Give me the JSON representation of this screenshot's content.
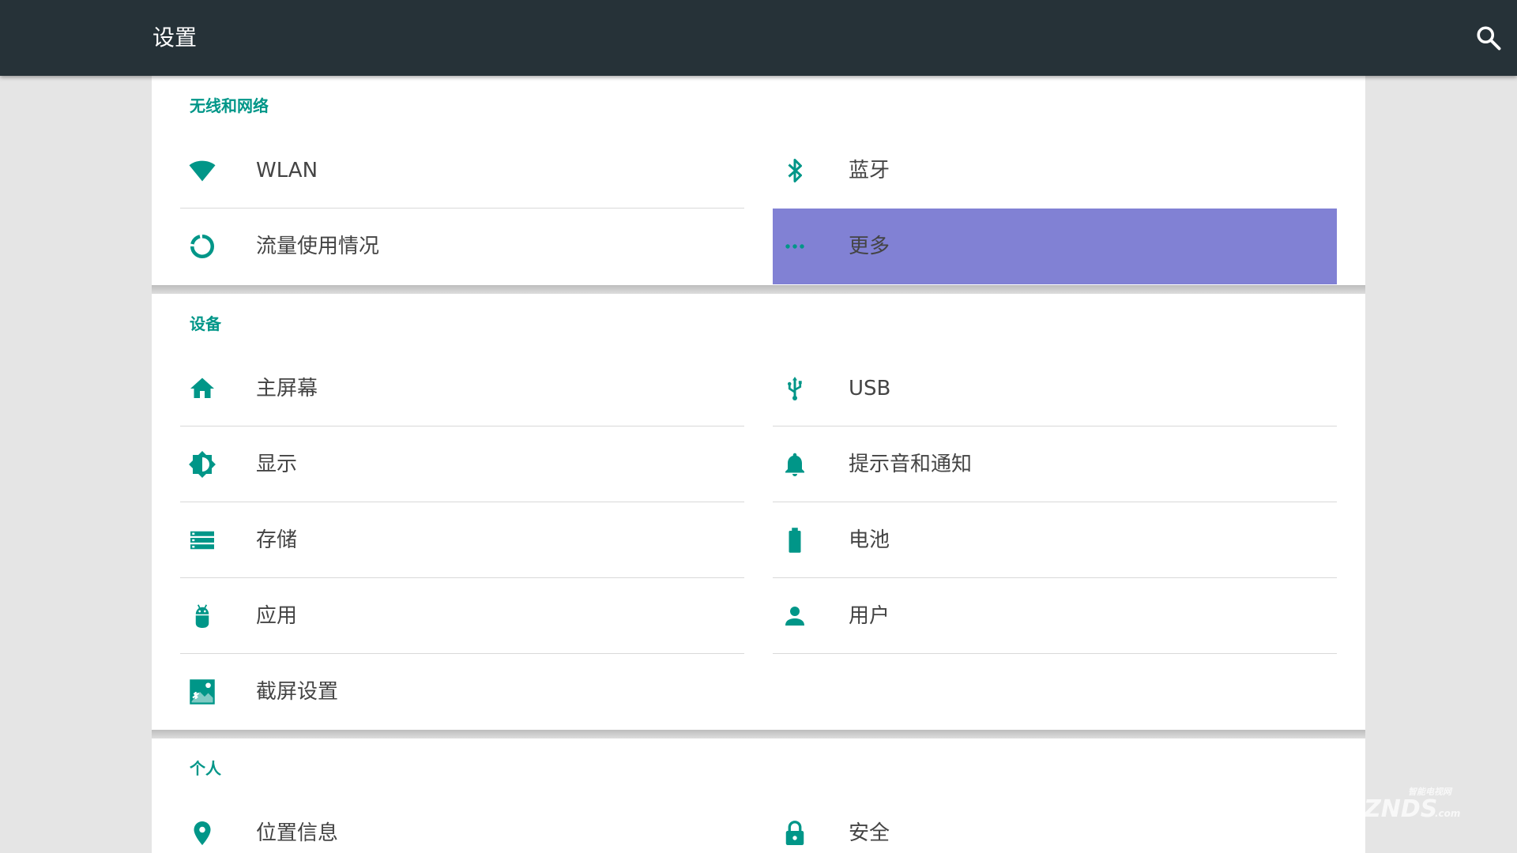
{
  "header": {
    "title": "设置"
  },
  "sections": [
    {
      "title": "无线和网络",
      "items": [
        {
          "label": "WLAN",
          "icon": "wifi-icon"
        },
        {
          "label": "蓝牙",
          "icon": "bluetooth-icon"
        },
        {
          "label": "流量使用情况",
          "icon": "data-usage-icon"
        },
        {
          "label": "更多",
          "icon": "more-dots-icon",
          "highlighted": true
        }
      ]
    },
    {
      "title": "设备",
      "items": [
        {
          "label": "主屏幕",
          "icon": "home-icon"
        },
        {
          "label": "USB",
          "icon": "usb-icon"
        },
        {
          "label": "显示",
          "icon": "brightness-icon"
        },
        {
          "label": "提示音和通知",
          "icon": "bell-icon"
        },
        {
          "label": "存储",
          "icon": "storage-icon"
        },
        {
          "label": "电池",
          "icon": "battery-icon"
        },
        {
          "label": "应用",
          "icon": "android-icon"
        },
        {
          "label": "用户",
          "icon": "person-icon"
        },
        {
          "label": "截屏设置",
          "icon": "screenshot-icon"
        }
      ]
    },
    {
      "title": "个人",
      "items": [
        {
          "label": "位置信息",
          "icon": "location-pin-icon"
        },
        {
          "label": "安全",
          "icon": "lock-icon"
        }
      ]
    }
  ],
  "colors": {
    "topbar": "#263238",
    "accent": "#009688",
    "highlight": "#8181d4",
    "background": "#e5e5e5"
  },
  "watermark": {
    "brand": "ZNDS",
    "sub": "智能电视网",
    "domain": ".com"
  }
}
